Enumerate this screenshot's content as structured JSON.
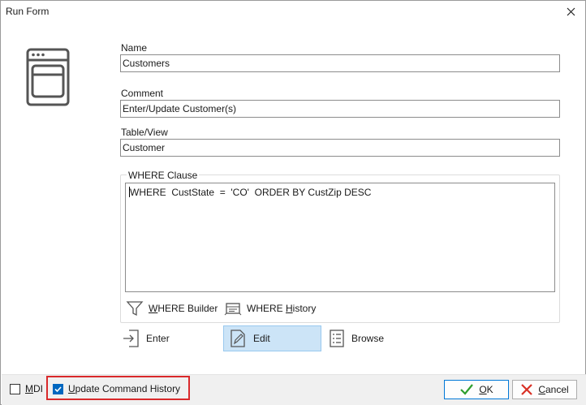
{
  "window": {
    "title": "Run Form"
  },
  "fields": {
    "name_label": "Name",
    "name_value": "Customers",
    "comment_label": "Comment",
    "comment_value": "Enter/Update Customer(s)",
    "table_label": "Table/View",
    "table_value": "Customer"
  },
  "where": {
    "group_label": "WHERE Clause",
    "text": "WHERE  CustState  =  'CO'  ORDER BY CustZip DESC",
    "builder_prefix": "W",
    "builder_rest": "HERE Builder",
    "history_prefix": "WHERE ",
    "history_underline": "H",
    "history_rest": "istory"
  },
  "actions": {
    "enter_underline": "E",
    "enter_rest": "nter",
    "edit_underline": "E",
    "edit_rest": "dit",
    "browse_label": "Browse",
    "selected": "Edit"
  },
  "footer": {
    "mdi_underline": "M",
    "mdi_rest": "DI",
    "mdi_checked": false,
    "history_underline": "U",
    "history_rest": "pdate Command History",
    "history_checked": true,
    "ok_underline": "O",
    "ok_rest": "K",
    "cancel_underline": "C",
    "cancel_rest": "ancel"
  },
  "colors": {
    "accent": "#0067c0",
    "selected_bg": "#cce4f7",
    "highlight": "#d9292b",
    "ok_check": "#2e9e2e",
    "cancel_x": "#d93025"
  },
  "icons": [
    "close-icon",
    "form-window-icon",
    "funnel-icon",
    "history-icon",
    "enter-icon",
    "edit-icon",
    "browse-icon",
    "checkmark-icon",
    "cancel-x-icon"
  ]
}
